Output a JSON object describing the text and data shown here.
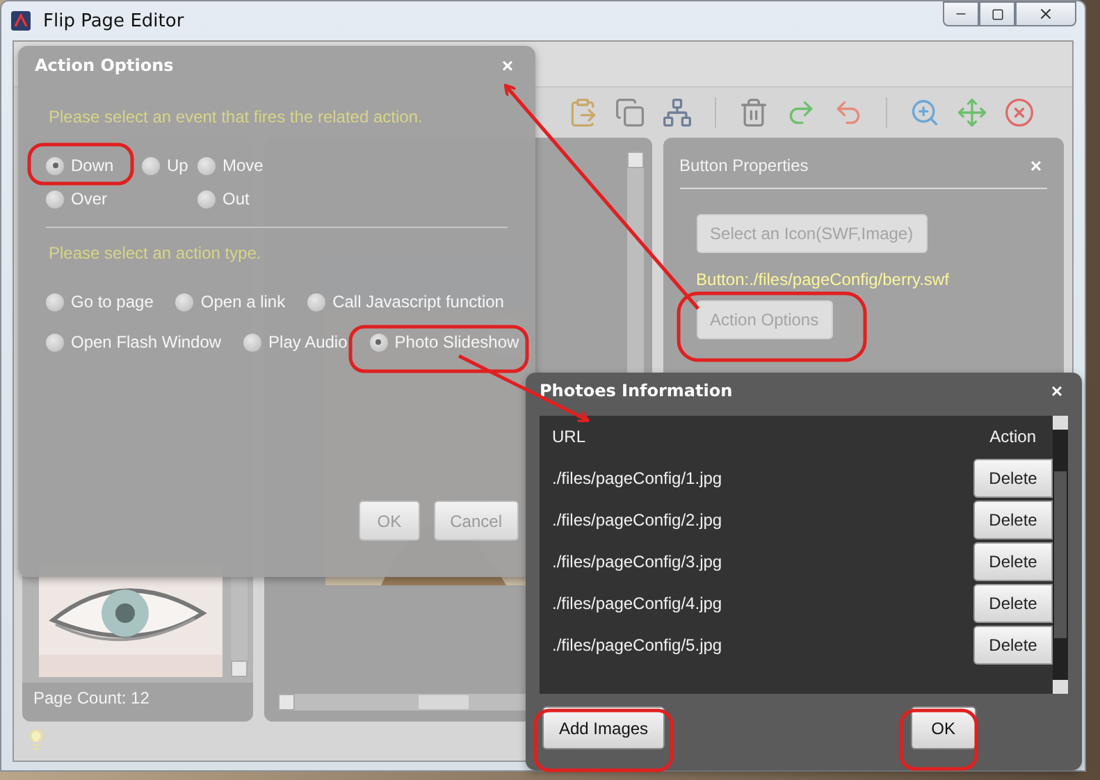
{
  "window": {
    "title": "Flip Page Editor"
  },
  "thumbnails_panel": {
    "page_count": "Page Count: 12"
  },
  "button_properties": {
    "title": "Button Properties",
    "close": "×",
    "select_icon_button": "Select an Icon(SWF,Image)",
    "button_path": "Button:./files/pageConfig/berry.swf",
    "action_options_button": "Action Options"
  },
  "action_options_dialog": {
    "title": "Action Options",
    "close": "×",
    "event_prompt": "Please select an event that fires the related action.",
    "events": [
      {
        "label": "Down",
        "selected": true
      },
      {
        "label": "Up",
        "selected": false
      },
      {
        "label": "Move",
        "selected": false
      },
      {
        "label": "Over",
        "selected": false
      },
      {
        "label": "Out",
        "selected": false
      }
    ],
    "action_prompt": "Please select an action type.",
    "action_rows": [
      [
        {
          "label": "Go to page",
          "selected": false
        },
        {
          "label": "Open a link",
          "selected": false
        },
        {
          "label": "Call Javascript function",
          "selected": false
        }
      ],
      [
        {
          "label": "Open Flash Window",
          "selected": false
        },
        {
          "label": "Play Audio",
          "selected": false
        },
        {
          "label": "Photo Slideshow",
          "selected": true
        }
      ]
    ],
    "buttons": [
      "OK",
      "Cancel"
    ]
  },
  "photos_dialog": {
    "title": "Photoes Information",
    "close": "×",
    "columns": [
      "URL",
      "Action"
    ],
    "rows": [
      {
        "url": "./files/pageConfig/1.jpg",
        "action": "Delete"
      },
      {
        "url": "./files/pageConfig/2.jpg",
        "action": "Delete"
      },
      {
        "url": "./files/pageConfig/3.jpg",
        "action": "Delete"
      },
      {
        "url": "./files/pageConfig/4.jpg",
        "action": "Delete"
      },
      {
        "url": "./files/pageConfig/5.jpg",
        "action": "Delete"
      }
    ],
    "buttons": [
      "Add Images",
      "OK"
    ]
  }
}
